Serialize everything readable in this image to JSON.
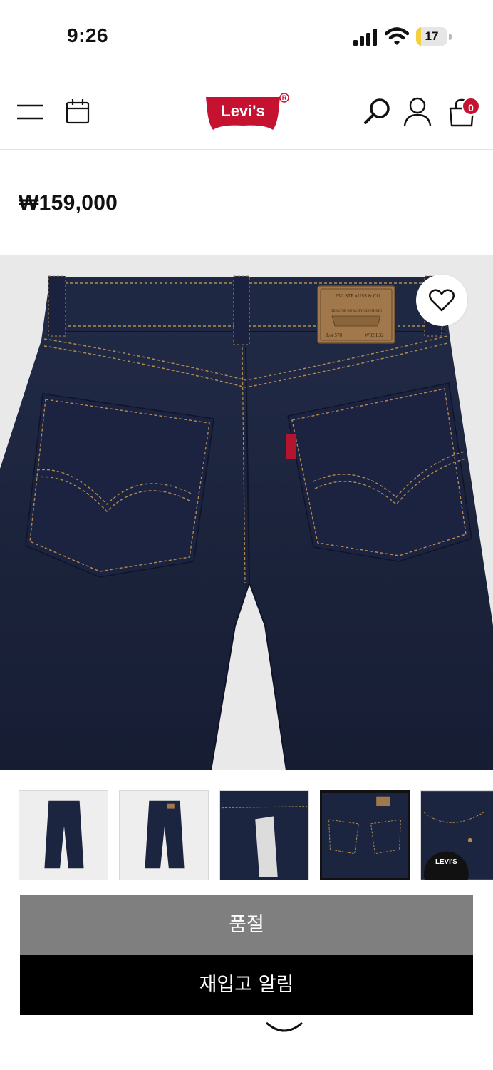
{
  "status_bar": {
    "time": "9:26",
    "battery_level": "17",
    "battery_fraction": 0.17
  },
  "header": {
    "logo_text": "Levi's",
    "logo_registered": "®",
    "cart_count": "0",
    "brand_color": "#c41230"
  },
  "product": {
    "price": "₩159,000",
    "patch": {
      "line1": "LEVI STRAUSS & CO",
      "line2": "GENUINE QUALITY CLOTHING",
      "lot": "Lot 578",
      "size": "W32 L32"
    }
  },
  "thumbnails": [
    {
      "label": "front-full",
      "selected": false
    },
    {
      "label": "back-full",
      "selected": false
    },
    {
      "label": "fly-detail",
      "selected": false
    },
    {
      "label": "back-pocket-detail",
      "selected": true
    },
    {
      "label": "front-pocket-detail",
      "selected": false
    }
  ],
  "thumb_badge": "LEVI'S",
  "actions": {
    "sold_out_label": "품절",
    "restock_label": "재입고 알림"
  },
  "colors": {
    "sold_out_bg": "#7f7f7f",
    "restock_bg": "#000000",
    "denim": "#1c2540",
    "stitch": "#b38a4e"
  }
}
